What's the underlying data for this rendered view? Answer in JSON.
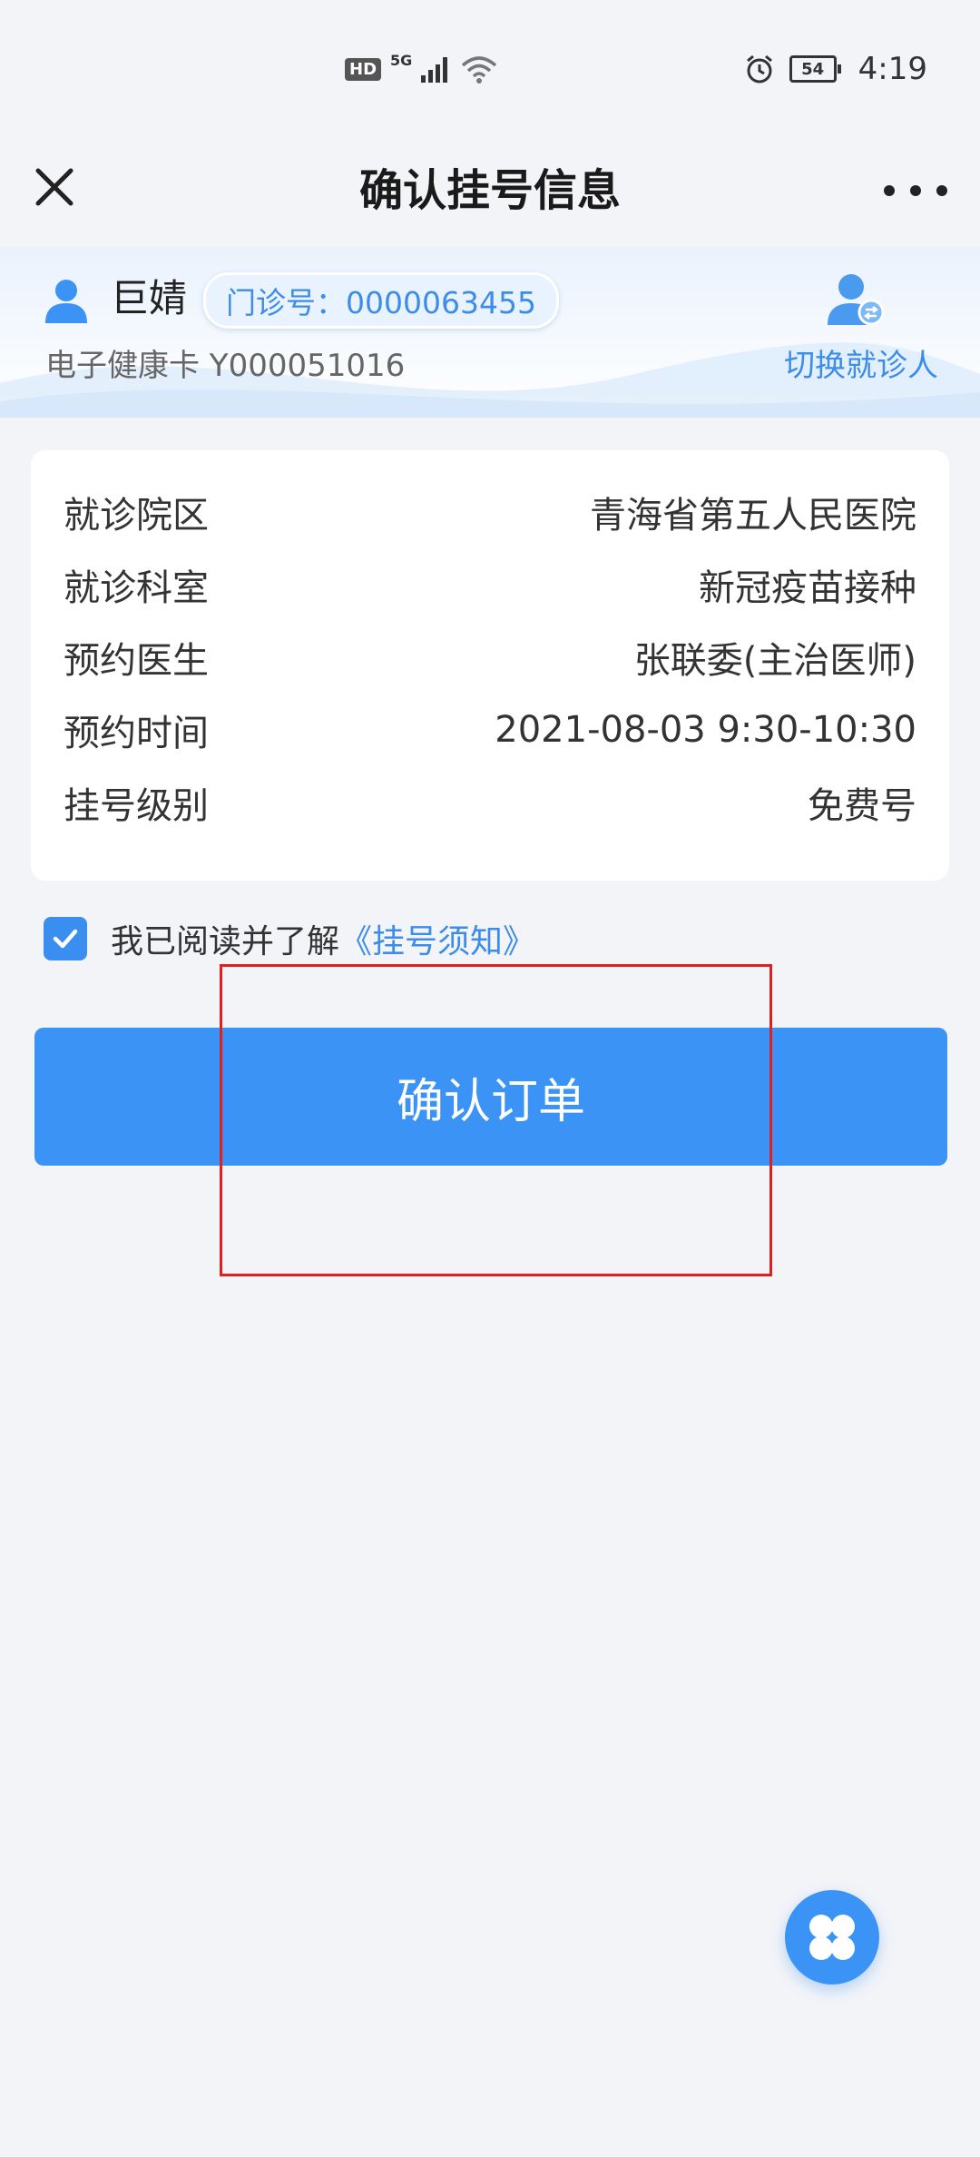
{
  "status_bar": {
    "hd_label": "HD",
    "network_label": "5G",
    "battery": "54",
    "time": "4:19",
    "icons": [
      "signal-icon",
      "wifi-icon",
      "alarm-icon",
      "battery-icon"
    ]
  },
  "nav": {
    "title": "确认挂号信息",
    "close_icon": "close-icon",
    "more_icon": "more-icon"
  },
  "patient": {
    "name": "巨婧",
    "clinic_number": "门诊号：0000063455",
    "health_card": "电子健康卡 Y000051016",
    "switch_label": "切换就诊人",
    "icons": [
      "user-icon",
      "switch-patient-icon"
    ]
  },
  "details": [
    {
      "label": "就诊院区",
      "value": "青海省第五人民医院"
    },
    {
      "label": "就诊科室",
      "value": "新冠疫苗接种"
    },
    {
      "label": "预约医生",
      "value": "张联委(主治医师)"
    },
    {
      "label": "预约时间",
      "value": "2021-08-03 9:30-10:30"
    },
    {
      "label": "挂号级别",
      "value": "免费号"
    }
  ],
  "agreement": {
    "checked": true,
    "text": "我已阅读并了解",
    "link_text": "《挂号须知》"
  },
  "confirm_button": {
    "label": "确认订单"
  },
  "colors": {
    "accent": "#3a93f5",
    "link": "#3d8de8",
    "background": "#f3f4f8",
    "highlight": "#e02020"
  },
  "fab_icon": "clover-menu-icon"
}
